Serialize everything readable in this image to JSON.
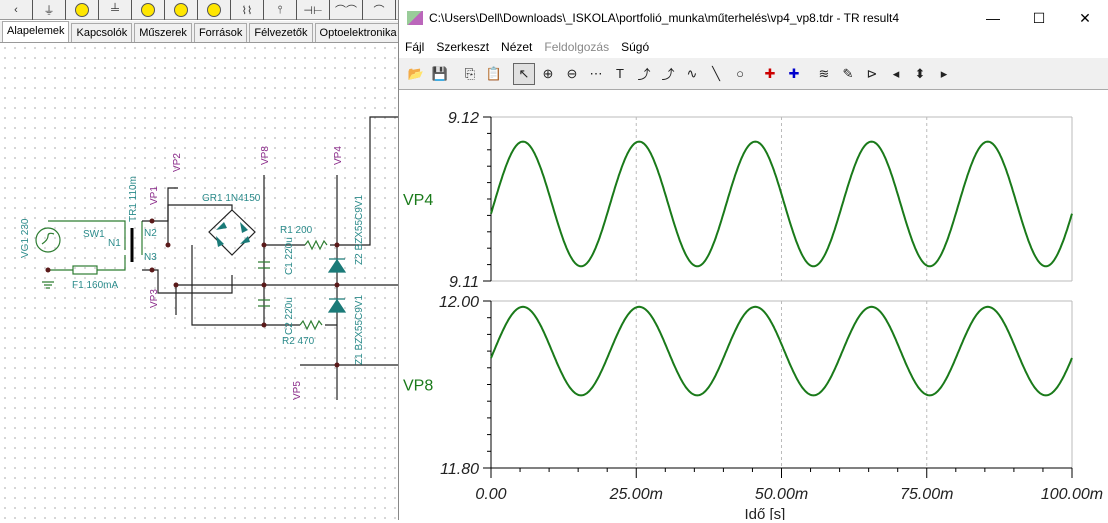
{
  "schematic": {
    "component_tabs": [
      "Alapelemek",
      "Kapcsolók",
      "Műszerek",
      "Források",
      "Félvezetők",
      "Optoelektronika"
    ],
    "active_tab": "Alapelemek",
    "labels": {
      "vg1": "VG1 230",
      "sw1": "SW1",
      "f1": "F1 160mA",
      "tr1": "TR1 110m",
      "n1": "N1",
      "n2": "N2",
      "n3": "N3",
      "gr1": "GR1 1N4150",
      "r1": "R1 200",
      "r2": "R2 470",
      "c1": "C1 220u",
      "c2": "C2 220u",
      "z1": "Z1 BZX55C9V1",
      "z2": "Z2 BZX55C9V1",
      "vp1": "VP1",
      "vp2": "VP2",
      "vp3": "VP3",
      "vp4": "VP4",
      "vp5": "VP5",
      "vp8": "VP8"
    }
  },
  "window": {
    "title": "C:\\Users\\Dell\\Downloads\\_ISKOLA\\portfolió_munka\\műterhelés\\vp4_vp8.tdr - TR result4",
    "controls": {
      "minimize": "—",
      "maximize": "☐",
      "close": "✕"
    },
    "menu": [
      {
        "label": "Fájl",
        "enabled": true
      },
      {
        "label": "Szerkeszt",
        "enabled": true
      },
      {
        "label": "Nézet",
        "enabled": true
      },
      {
        "label": "Feldolgozás",
        "enabled": false
      },
      {
        "label": "Súgó",
        "enabled": true
      }
    ],
    "toolbar": [
      {
        "icon": "open-icon",
        "g": "📂"
      },
      {
        "icon": "save-icon",
        "g": "💾"
      },
      {
        "sep": true
      },
      {
        "icon": "copy-icon",
        "g": "⎘"
      },
      {
        "icon": "paste-icon",
        "g": "📋"
      },
      {
        "sep": true
      },
      {
        "icon": "pointer-icon",
        "g": "↖",
        "selected": true
      },
      {
        "icon": "zoom-in-icon",
        "g": "⊕"
      },
      {
        "icon": "zoom-100-icon",
        "g": "⊖"
      },
      {
        "icon": "grid-icon",
        "g": "⋯"
      },
      {
        "icon": "text-icon",
        "g": "T"
      },
      {
        "icon": "curve-label-icon",
        "g": "⤴"
      },
      {
        "icon": "curve-query-icon",
        "g": "⤴"
      },
      {
        "icon": "formula-icon",
        "g": "∿"
      },
      {
        "icon": "line-icon",
        "g": "╲"
      },
      {
        "icon": "circle-icon",
        "g": "○"
      },
      {
        "sep": true
      },
      {
        "icon": "cursor-a-icon",
        "g": "✚"
      },
      {
        "icon": "cursor-b-icon",
        "g": "✚"
      },
      {
        "sep": true
      },
      {
        "icon": "add-curve-icon",
        "g": "≋"
      },
      {
        "icon": "probe-icon",
        "g": "✎"
      },
      {
        "icon": "flag-icon",
        "g": "⊳"
      },
      {
        "icon": "arrow-left-icon",
        "g": "◂"
      },
      {
        "icon": "arrow-updown-icon",
        "g": "⬍"
      },
      {
        "icon": "arrow-right-icon",
        "g": "▸"
      }
    ]
  },
  "chart_data": [
    {
      "type": "line",
      "series": [
        {
          "name": "VP4",
          "period_ms": 20,
          "peak_at_ms": 5.5,
          "mean": 9.1147,
          "amplitude": 0.0038
        }
      ],
      "ylim": [
        9.11,
        9.12
      ],
      "yticks": [
        "9.12",
        "9.11"
      ],
      "xlim": [
        0,
        0.1
      ],
      "grid": "vertical dashed at x ticks",
      "color": "#1a7a1a"
    },
    {
      "type": "line",
      "series": [
        {
          "name": "VP8",
          "period_ms": 20,
          "peak_at_ms": 5.5,
          "mean": 11.94,
          "amplitude": 0.053
        }
      ],
      "ylim": [
        11.8,
        12.0
      ],
      "yticks": [
        "12.00",
        "11.80"
      ],
      "xlim": [
        0,
        0.1
      ],
      "xticks": [
        "0.00",
        "25.00m",
        "50.00m",
        "75.00m",
        "100.00m"
      ],
      "xlabel": "Idő [s]",
      "color": "#1a7a1a"
    }
  ]
}
